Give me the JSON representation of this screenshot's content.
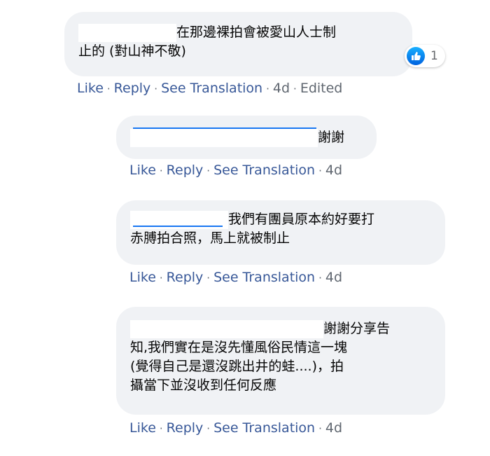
{
  "comments": [
    {
      "text_line1": "在那邊裸拍會被愛山人士制",
      "text_line2": "止的 (對山神不敬)",
      "reaction_count": "1",
      "actions": {
        "like": "Like",
        "reply": "Reply",
        "translate": "See Translation",
        "time": "4d",
        "edited": "Edited"
      }
    },
    {
      "text_line1": "謝謝",
      "actions": {
        "like": "Like",
        "reply": "Reply",
        "translate": "See Translation",
        "time": "4d"
      }
    },
    {
      "text_line1": "我們有團員原本約好要打",
      "text_line2": "赤膊拍合照，馬上就被制止",
      "actions": {
        "like": "Like",
        "reply": "Reply",
        "translate": "See Translation",
        "time": "4d"
      }
    },
    {
      "text_line1": "謝謝分享告",
      "text_line2": "知,我們實在是沒先懂風俗民情這一塊",
      "text_line3": "(覺得自己是還沒跳出井的蛙....)，拍",
      "text_line4": "攝當下並沒收到任何反應",
      "actions": {
        "like": "Like",
        "reply": "Reply",
        "translate": "See Translation",
        "time": "4d"
      }
    }
  ],
  "separator": "·",
  "colors": {
    "bubble": "#f0f2f5",
    "link": "#385898",
    "like_blue": "#1877f2"
  }
}
